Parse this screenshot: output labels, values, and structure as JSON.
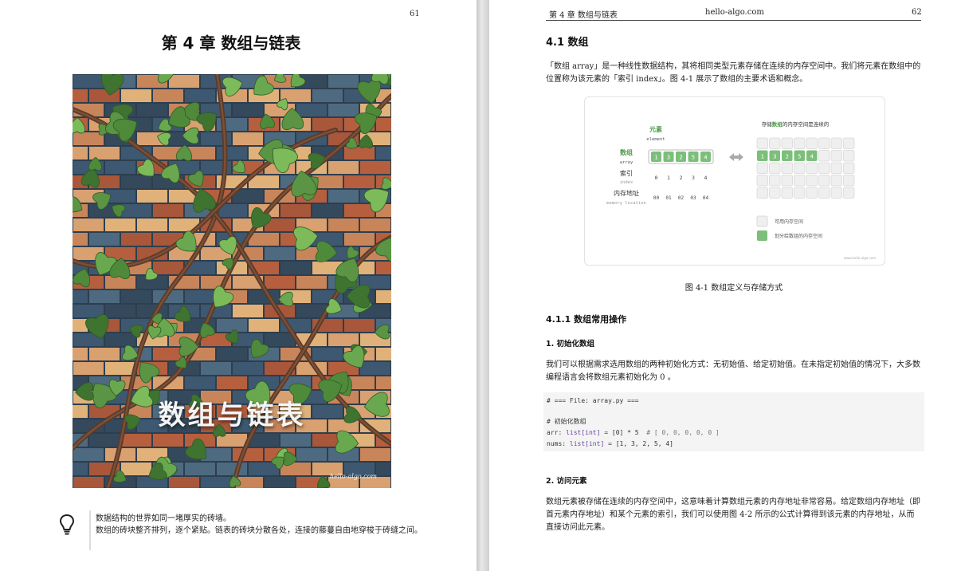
{
  "left_page": {
    "page_number": "61",
    "chapter_title": "第 4 章   数组与链表",
    "cover": {
      "title": "数组与链表",
      "site": "hello-algo.com"
    },
    "quote": {
      "icon": "lightbulb-icon",
      "line1": "数据结构的世界如同一堵厚实的砖墙。",
      "line2": "数组的砖块整齐排列，逐个紧贴。链表的砖块分散各处，连接的藤蔓自由地穿梭于砖缝之间。"
    }
  },
  "right_page": {
    "header": {
      "chapter": "第 4 章   数组与链表",
      "site": "hello-algo.com",
      "page_number": "62"
    },
    "section_title": "4.1   数组",
    "intro": "「数组 array」是一种线性数据结构，其将相同类型元素存储在连续的内存空间中。我们将元素在数组中的位置称为该元素的「索引 index」。图 4-1 展示了数组的主要术语和概念。",
    "figure": {
      "element_label": "元素",
      "element_label_en": "element",
      "array_label": "数组",
      "array_label_en": "array",
      "index_label": "索引",
      "index_label_en": "index",
      "memory_label": "内存地址",
      "memory_label_en": "memory location",
      "values": [
        "1",
        "3",
        "2",
        "5",
        "4"
      ],
      "indices": [
        "0",
        "1",
        "2",
        "3",
        "4"
      ],
      "addresses": [
        "00",
        "01",
        "02",
        "03",
        "04"
      ],
      "memory_title_pre": "存储",
      "memory_title_hl": "数组",
      "memory_title_post": "的内存空间是连续的",
      "legend_free": "可用内存空间",
      "legend_used": "划分给数组的内存空间",
      "watermark": "www.hello-algo.com",
      "colors": {
        "green": "#7cbf7a",
        "green_text": "#4a9a48",
        "gray_cell": "#efefef"
      }
    },
    "figure_caption": "图 4-1   数组定义与存储方式",
    "subsection_title": "4.1.1   数组常用操作",
    "init_title": "1.   初始化数组",
    "init_para": "我们可以根据需求选用数组的两种初始化方式：无初始值、给定初始值。在未指定初始值的情况下，大多数编程语言会将数组元素初始化为 0 。",
    "code": {
      "file_comment": "# === File: array.py ===",
      "comment": "# 初始化数组",
      "line1_var": "arr: ",
      "line1_type": "list[int]",
      "line1_rest": " = [0] * 5  ",
      "line1_comment": "# [ 0, 0, 0, 0, 0 ]",
      "line2_var": "nums: ",
      "line2_type": "list[int]",
      "line2_rest": " = [1, 3, 2, 5, 4]"
    },
    "access_title": "2.   访问元素",
    "access_para": "数组元素被存储在连续的内存空间中，这意味着计算数组元素的内存地址非常容易。给定数组内存地址（即首元素内存地址）和某个元素的索引，我们可以使用图 4-2 所示的公式计算得到该元素的内存地址，从而直接访问此元素。"
  }
}
